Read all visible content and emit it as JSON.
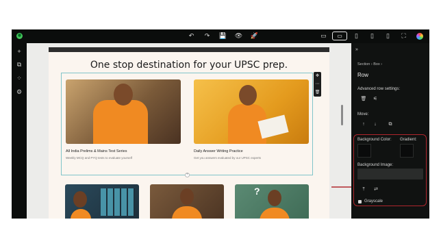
{
  "toolbar": {
    "logo_icon": "builder-logo-icon",
    "undo_icon": "↶",
    "redo_icon": "↷",
    "save_icon": "💾",
    "preview_icon": "👁",
    "publish_icon": "🚀",
    "device_desktop": "▭",
    "device_laptop": "▭",
    "device_tablet_l": "▯",
    "device_tablet": "▯",
    "device_mobile": "▯",
    "fullscreen_icon": "⛶"
  },
  "left_rail": {
    "add_icon": "+",
    "pages_icon": "⧉",
    "blocks_icon": "⁘",
    "settings_icon": "⚙"
  },
  "page": {
    "headline": "One stop destination for your UPSC prep.",
    "cards": [
      {
        "title": "All India Prelims & Mains Test Series",
        "subtitle": "Weekly MCQ and PYQ tests to evaluate yourself"
      },
      {
        "title": "Daily Answer Writing Practice",
        "subtitle": "Get you answers evaluated by our UPSC experts"
      }
    ],
    "row_tools": {
      "move": "✥",
      "drag": "⋯",
      "delete": "🗑"
    },
    "add_row": "+"
  },
  "panel": {
    "collapse_icon": "»",
    "breadcrumb": [
      "Section",
      "›",
      "Box",
      "›"
    ],
    "title": "Row",
    "advanced_label": "Advanced row settings:",
    "adv_icons": {
      "delete": "🗑",
      "settings": "⚟"
    },
    "move_label": "Move:",
    "move_icons": {
      "up": "↑",
      "down": "↓",
      "copy": "⧉"
    },
    "bg_color_label": "Background Color:",
    "gradient_label": "Gradient:",
    "bg_image_label": "Background Image:",
    "img_icons": {
      "upload": "⤒",
      "swap": "⇄"
    },
    "grayscale_label": "Grayscale"
  },
  "colors": {
    "accent_red": "#b0262c",
    "row_outline": "#7fc4c9",
    "shirt_orange": "#f08a22"
  }
}
